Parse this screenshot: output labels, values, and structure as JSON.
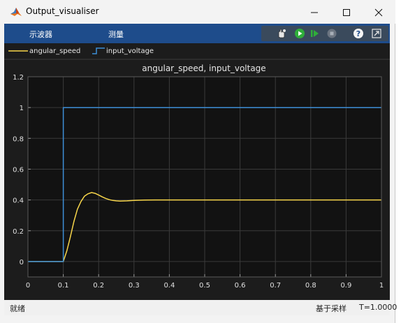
{
  "window": {
    "title": "Output_visualiser",
    "icon": "matlab-logo-icon",
    "controls": [
      "minimize-icon",
      "maximize-icon",
      "close-icon"
    ]
  },
  "toolstrip": {
    "menu": [
      "示波器",
      "测量"
    ],
    "tools": [
      "config-icon",
      "run-icon",
      "step-forward-icon",
      "stop-icon",
      "help-icon",
      "undock-icon"
    ],
    "accent": "#1e4c8b"
  },
  "legend": {
    "items": [
      {
        "label": "angular_speed",
        "color": "#f7d54a"
      },
      {
        "label": "input_voltage",
        "color": "#3d8fd6"
      }
    ]
  },
  "chart_data": {
    "type": "line",
    "title": "angular_speed, input_voltage",
    "xlim": [
      0,
      1
    ],
    "ylim": [
      -0.1,
      1.2
    ],
    "xticks": [
      "0",
      "0.1",
      "0.2",
      "0.3",
      "0.4",
      "0.5",
      "0.6",
      "0.7",
      "0.8",
      "0.9",
      "1"
    ],
    "yticks": [
      "0",
      "0.2",
      "0.4",
      "0.6",
      "0.8",
      "1",
      "1.2"
    ],
    "grid": true,
    "series": [
      {
        "name": "angular_speed",
        "color": "#f7d54a",
        "x": [
          0,
          0.1,
          0.11,
          0.12,
          0.13,
          0.14,
          0.15,
          0.16,
          0.17,
          0.18,
          0.19,
          0.2,
          0.21,
          0.22,
          0.23,
          0.24,
          0.25,
          0.26,
          0.28,
          0.3,
          0.33,
          0.36,
          0.4,
          0.5,
          1.0
        ],
        "y": [
          0,
          0,
          0.07,
          0.16,
          0.26,
          0.34,
          0.39,
          0.425,
          0.44,
          0.448,
          0.443,
          0.432,
          0.42,
          0.41,
          0.402,
          0.397,
          0.394,
          0.393,
          0.394,
          0.397,
          0.399,
          0.4,
          0.4,
          0.4,
          0.4
        ]
      },
      {
        "name": "input_voltage",
        "color": "#3d8fd6",
        "x": [
          0,
          0.1,
          0.1,
          1.0
        ],
        "y": [
          0,
          0,
          1,
          1
        ]
      }
    ]
  },
  "status": {
    "left": "就绪",
    "mode": "基于采样",
    "time": "T=1.0000"
  }
}
